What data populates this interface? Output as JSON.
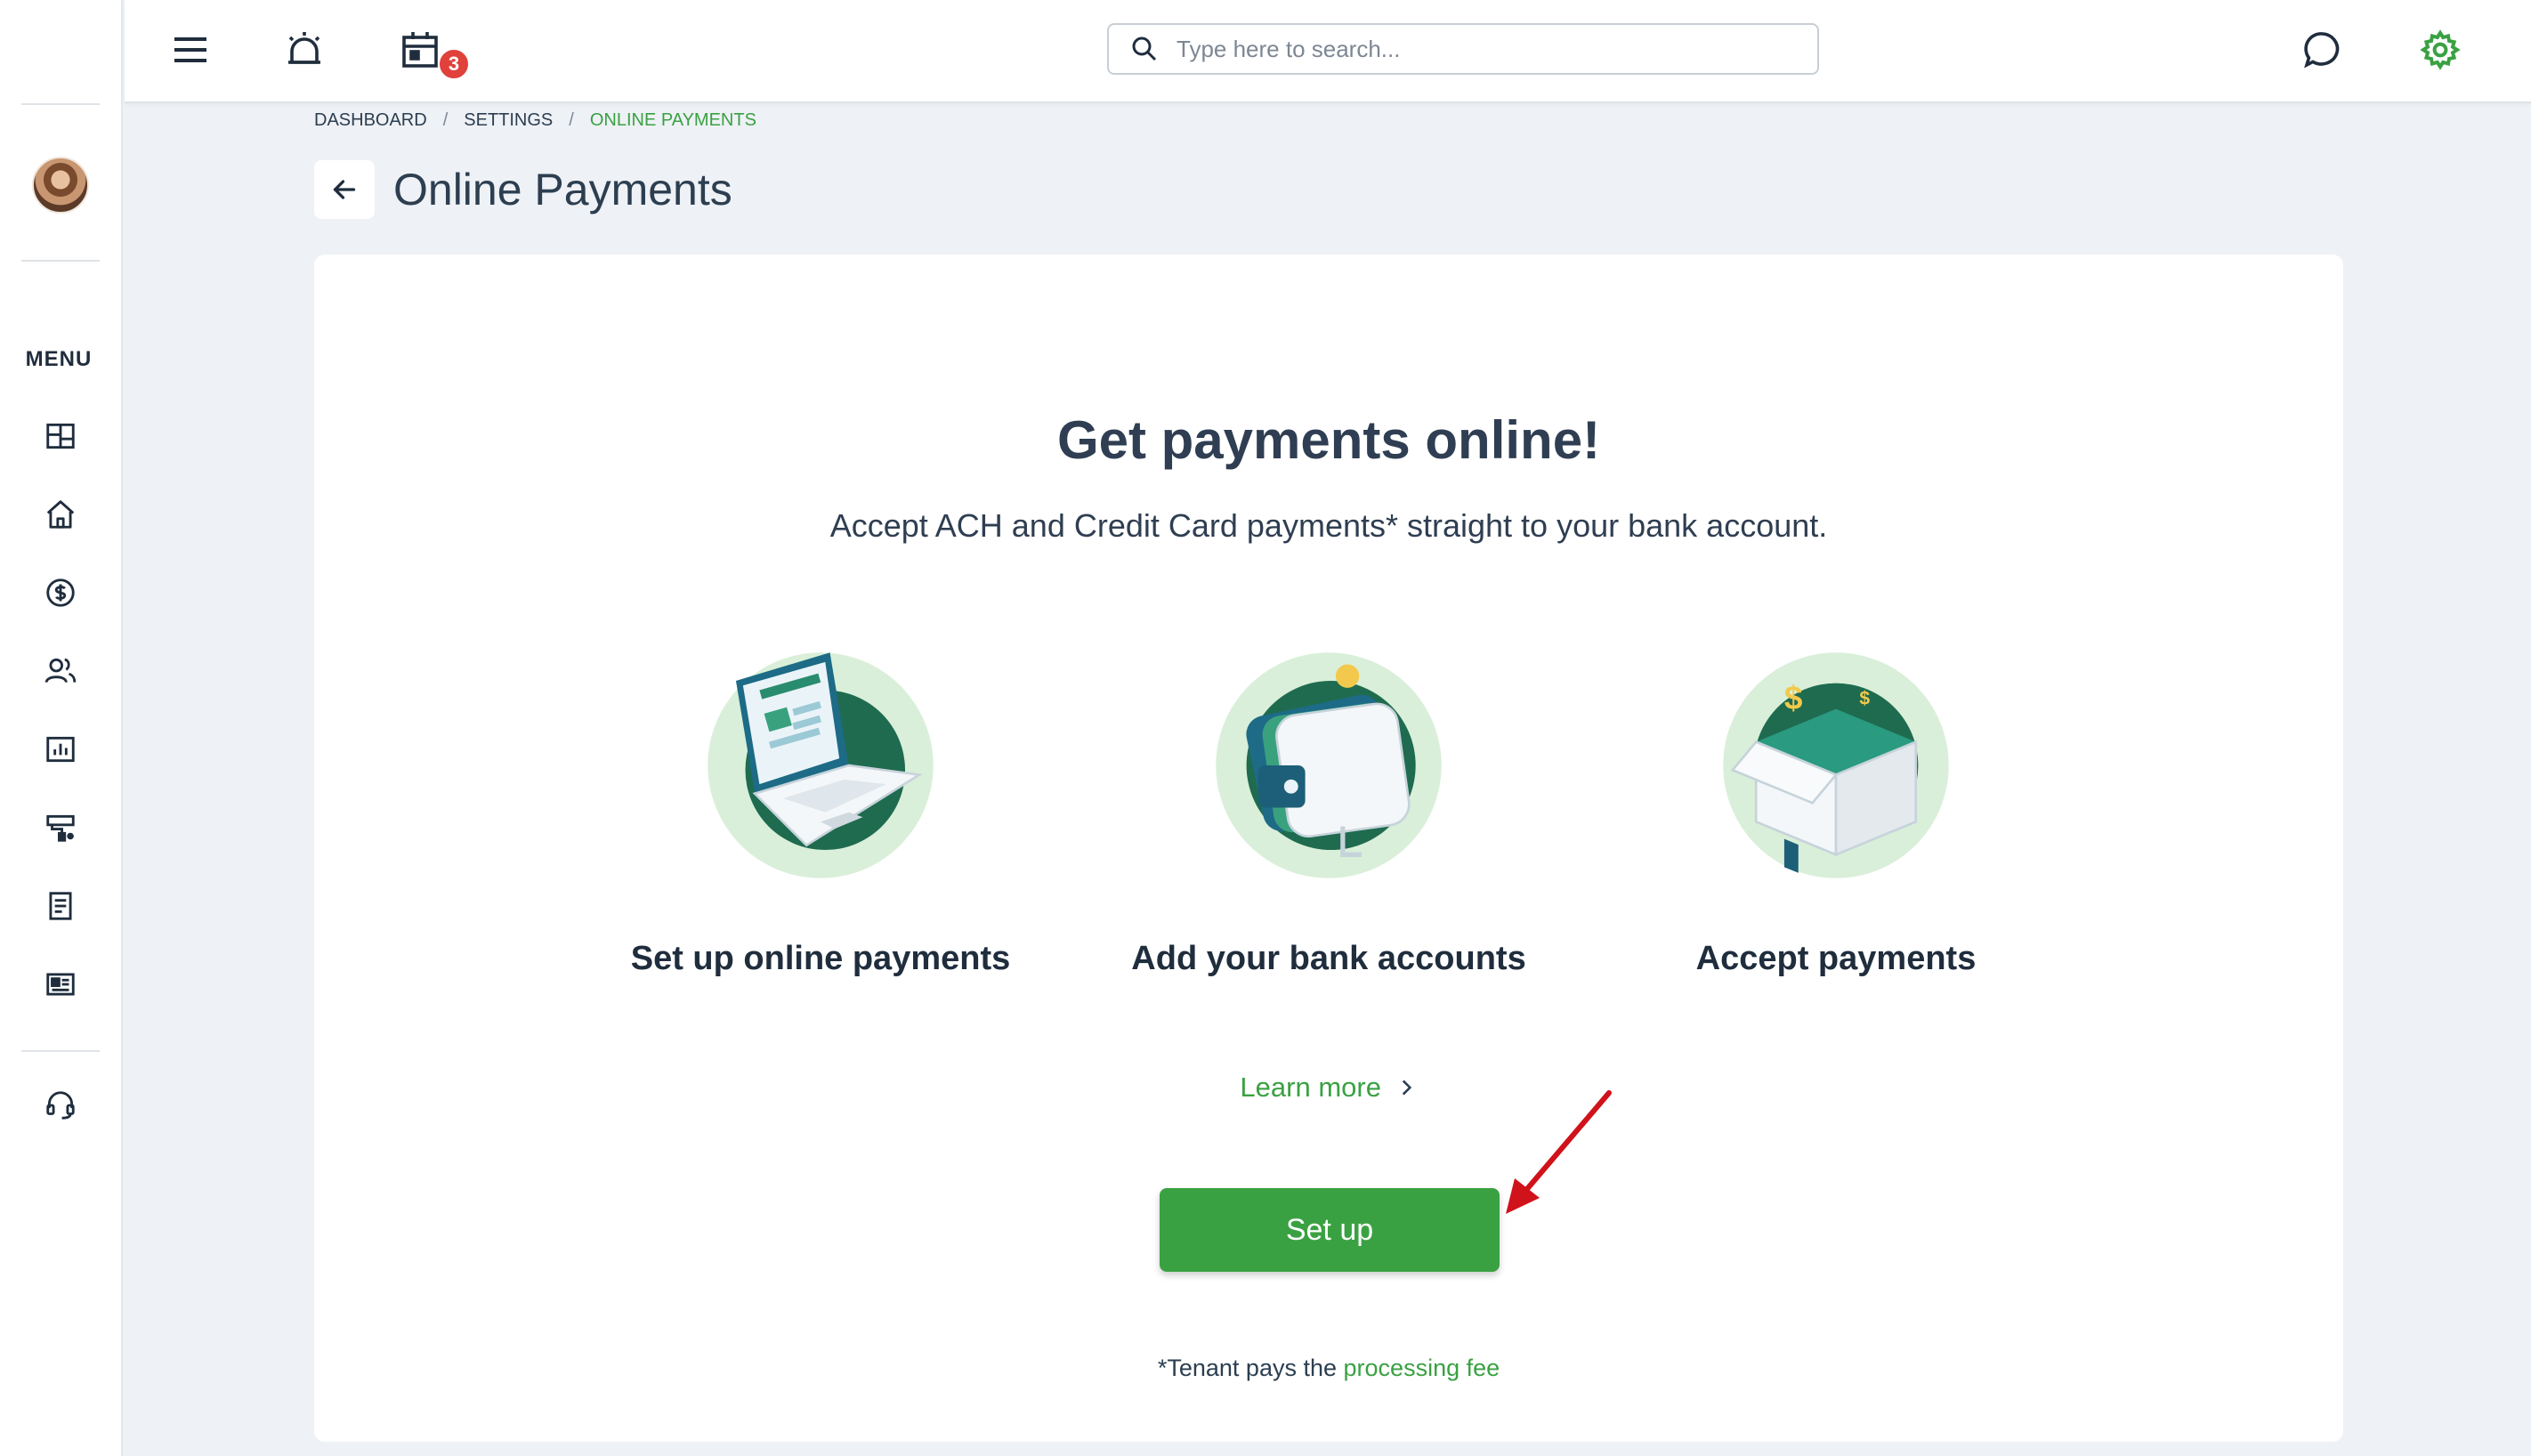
{
  "sidebar": {
    "menu_label": "MENU",
    "items": [
      {
        "icon": "dashboard-icon"
      },
      {
        "icon": "home-icon"
      },
      {
        "icon": "dollar-icon"
      },
      {
        "icon": "people-icon"
      },
      {
        "icon": "reports-icon"
      },
      {
        "icon": "maintenance-icon"
      },
      {
        "icon": "document-icon"
      },
      {
        "icon": "listing-icon"
      }
    ],
    "support_icon": "headset-icon"
  },
  "topbar": {
    "notification_count": "3",
    "search": {
      "placeholder": "Type here to search..."
    }
  },
  "breadcrumb": {
    "items": [
      "DASHBOARD",
      "SETTINGS",
      "ONLINE PAYMENTS"
    ],
    "separator": "/"
  },
  "page": {
    "title": "Online Payments"
  },
  "card": {
    "heading": "Get payments online!",
    "subheading": "Accept ACH and Credit Card payments* straight to your bank account.",
    "features": [
      {
        "label": "Set up online payments",
        "icon": "laptop-illustration"
      },
      {
        "label": "Add your bank accounts",
        "icon": "wallet-illustration"
      },
      {
        "label": "Accept payments",
        "icon": "house-box-illustration"
      }
    ],
    "learn_more": "Learn more",
    "setup_button": "Set up",
    "footnote_prefix": "*Tenant pays the",
    "footnote_link": "processing fee"
  },
  "colors": {
    "accent": "#3aa142",
    "badge": "#e0413b",
    "text": "#2c3e50",
    "annotation_arrow": "#d0121b"
  }
}
